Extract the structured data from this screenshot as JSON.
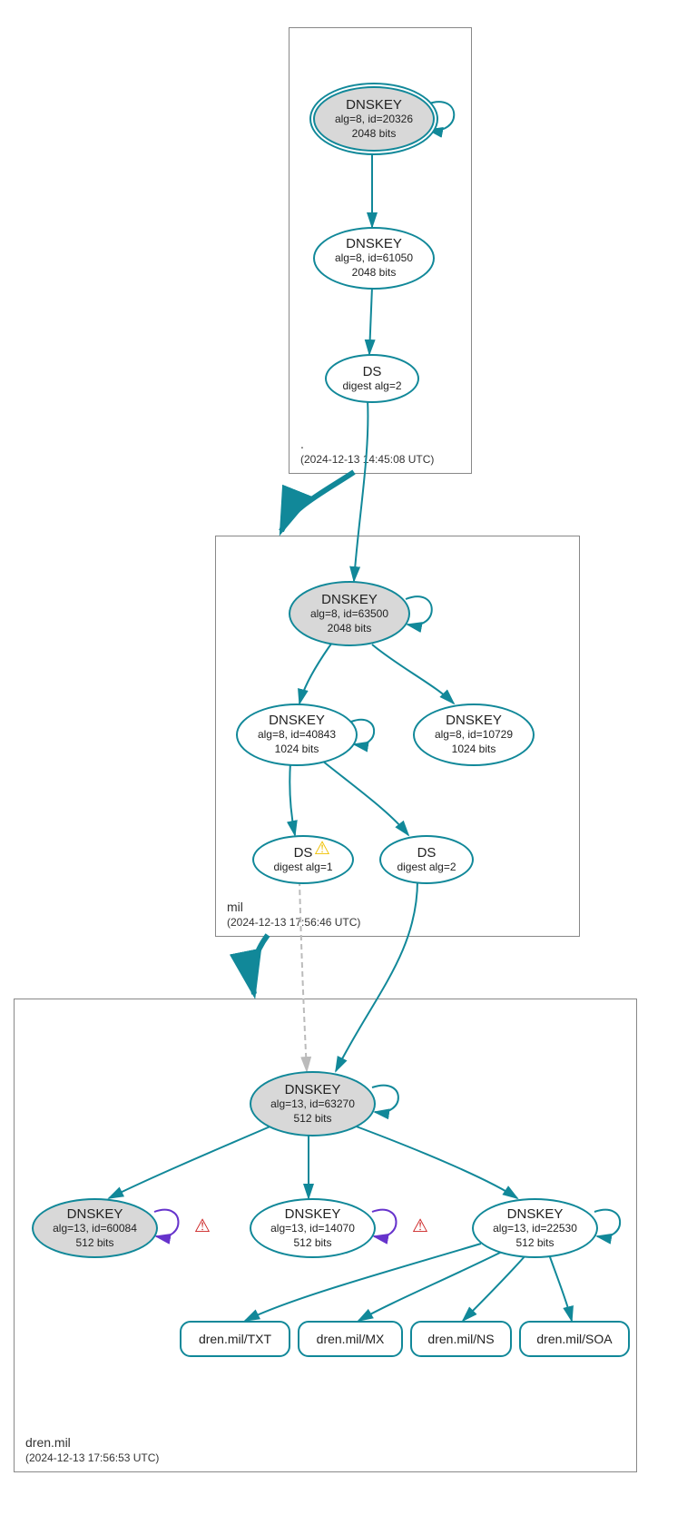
{
  "zones": {
    "root": {
      "name": ".",
      "time": "(2024-12-13 14:45:08 UTC)"
    },
    "mil": {
      "name": "mil",
      "time": "(2024-12-13 17:56:46 UTC)"
    },
    "dren": {
      "name": "dren.mil",
      "time": "(2024-12-13 17:56:53 UTC)"
    }
  },
  "nodes": {
    "root_ksk": {
      "title": "DNSKEY",
      "line1": "alg=8, id=20326",
      "line2": "2048 bits"
    },
    "root_zsk": {
      "title": "DNSKEY",
      "line1": "alg=8, id=61050",
      "line2": "2048 bits"
    },
    "root_ds": {
      "title": "DS",
      "line1": "digest alg=2"
    },
    "mil_ksk": {
      "title": "DNSKEY",
      "line1": "alg=8, id=63500",
      "line2": "2048 bits"
    },
    "mil_zsk1": {
      "title": "DNSKEY",
      "line1": "alg=8, id=40843",
      "line2": "1024 bits"
    },
    "mil_zsk2": {
      "title": "DNSKEY",
      "line1": "alg=8, id=10729",
      "line2": "1024 bits"
    },
    "mil_ds1": {
      "title": "DS",
      "line1": "digest alg=1"
    },
    "mil_ds2": {
      "title": "DS",
      "line1": "digest alg=2"
    },
    "dren_ksk": {
      "title": "DNSKEY",
      "line1": "alg=13, id=63270",
      "line2": "512 bits"
    },
    "dren_k1": {
      "title": "DNSKEY",
      "line1": "alg=13, id=60084",
      "line2": "512 bits"
    },
    "dren_k2": {
      "title": "DNSKEY",
      "line1": "alg=13, id=14070",
      "line2": "512 bits"
    },
    "dren_k3": {
      "title": "DNSKEY",
      "line1": "alg=13, id=22530",
      "line2": "512 bits"
    },
    "dren_txt": {
      "title": "dren.mil/TXT"
    },
    "dren_mx": {
      "title": "dren.mil/MX"
    },
    "dren_ns": {
      "title": "dren.mil/NS"
    },
    "dren_soa": {
      "title": "dren.mil/SOA"
    }
  },
  "colors": {
    "teal": "#118899",
    "purple": "#6633cc",
    "gray": "#bbbbbb"
  }
}
